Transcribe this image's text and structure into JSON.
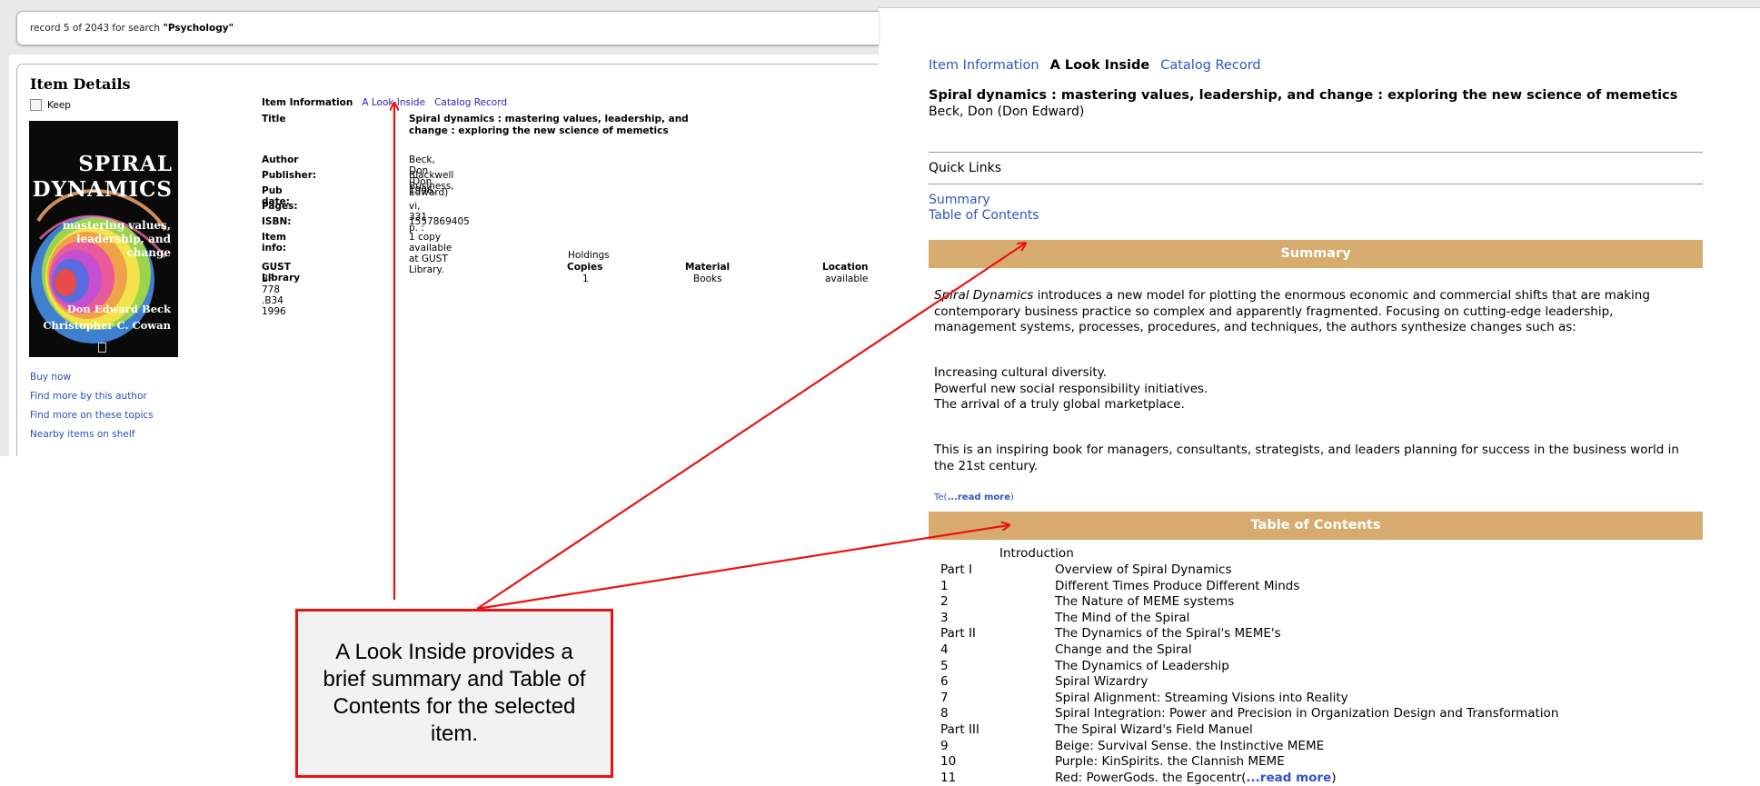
{
  "search_header": {
    "record_prefix": "record 5 of 2043 for search ",
    "query": "\"Psychology\""
  },
  "item_details": {
    "heading": "Item Details",
    "keep_label": "Keep",
    "cover": {
      "title_line1": "SPIRAL",
      "title_line2": "DYNAMICS",
      "subtitle_line1": "mastering values,",
      "subtitle_line2": "leadership, and",
      "subtitle_line3": "change",
      "author_line1": "Don Edward Beck",
      "author_line2": "Christopher C. Cowan"
    },
    "side_links": [
      "Buy now",
      "Find more by this author",
      "Find more on these topics",
      "Nearby items on shelf"
    ]
  },
  "left_nav": {
    "current": "Item Information",
    "look_inside": "A Look Inside",
    "catalog_record": "Catalog Record"
  },
  "fields": {
    "title_label": "Title",
    "title_value": "Spiral dynamics : mastering values, leadership, and change : exploring the new science of memetics",
    "author_label": "Author",
    "author_value": "Beck, Don (Don Edward)",
    "publisher_label": "Publisher:",
    "publisher_value": "Blackwell Business,",
    "pubdate_label": "Pub date:",
    "pubdate_value": "1996.",
    "pages_label": "Pages:",
    "pages_value": "vi, 331 p. :",
    "isbn_label": "ISBN:",
    "isbn_value": "1557869405",
    "iteminfo_label": "Item info:",
    "iteminfo_value": "1 copy available at GUST Library."
  },
  "holdings": {
    "library": "GUST Library",
    "call_number": "BF 778 .B34 1996",
    "holdings_header": "Holdings",
    "copies_header": "Copies",
    "copies_value": "1",
    "material_header": "Material",
    "material_value": "Books",
    "location_header": "Location",
    "location_value": "available"
  },
  "right_nav": {
    "item_information": "Item Information",
    "current": "A Look Inside",
    "catalog_record": "Catalog Record"
  },
  "look_inside": {
    "book_title": "Spiral dynamics : mastering values, leadership, and change : exploring the new science of memetics",
    "book_author": "Beck, Don (Don Edward)",
    "quick_links_label": "Quick Links",
    "summary_link": "Summary",
    "toc_link": "Table of Contents",
    "summary_heading": "Summary",
    "summary_p1_em": "Spiral Dynamics",
    "summary_p1_rest": " introduces a new model for plotting the enormous economic and commercial shifts that are making contemporary business practice so complex and apparently fragmented. Focusing on cutting-edge leadership, management systems, processes, procedures, and techniques, the authors synthesize changes such as:",
    "summary_list": [
      "Increasing cultural diversity.",
      "Powerful new social responsibility initiatives.",
      "The arrival of a truly global marketplace."
    ],
    "summary_p3": "This is an inspiring book for managers, consultants, strategists, and leaders planning for success in the business world in the 21st century.",
    "summary_more_prefix": "Te(",
    "summary_more_link": "...read more",
    "summary_more_suffix": ")",
    "toc_heading": "Table of Contents",
    "toc_intro": "Introduction",
    "toc": [
      {
        "num": "Part I",
        "title": "Overview of Spiral Dynamics"
      },
      {
        "num": "1",
        "title": "Different Times Produce Different Minds"
      },
      {
        "num": "2",
        "title": "The Nature of MEME systems"
      },
      {
        "num": "3",
        "title": "The Mind of the Spiral"
      },
      {
        "num": "Part II",
        "title": "The Dynamics of the Spiral's MEME's"
      },
      {
        "num": "4",
        "title": "Change and the Spiral"
      },
      {
        "num": "5",
        "title": "The Dynamics of Leadership"
      },
      {
        "num": "6",
        "title": "Spiral Wizardry"
      },
      {
        "num": "7",
        "title": "Spiral Alignment: Streaming Visions into Reality"
      },
      {
        "num": "8",
        "title": "Spiral Integration: Power and Precision in Organization Design and Transformation"
      },
      {
        "num": "Part III",
        "title": "The Spiral Wizard's Field Manuel"
      },
      {
        "num": "9",
        "title": "Beige: Survival Sense. the Instinctive MEME"
      },
      {
        "num": "10",
        "title": "Purple: KinSpirits. the Clannish MEME"
      },
      {
        "num": "11",
        "title": "Red: PowerGods. the Egocentr("
      }
    ],
    "toc_more_link": "...read more",
    "toc_more_suffix": ")"
  },
  "annotation": {
    "callout_text": "A Look Inside provides a brief summary and Table of Contents for the selected item.",
    "arrow_color": "#ee1111"
  }
}
